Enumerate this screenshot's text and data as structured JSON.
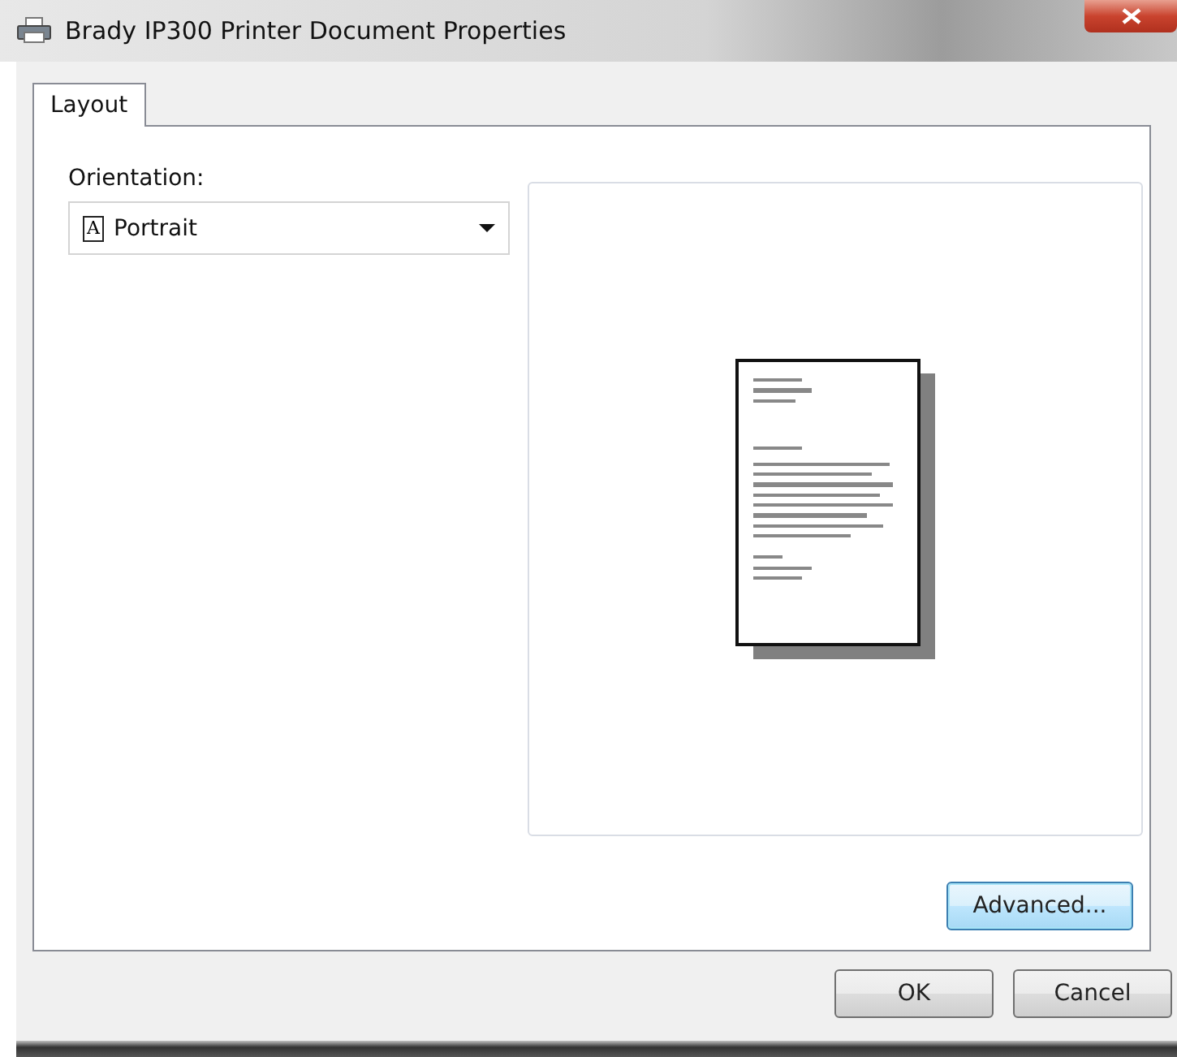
{
  "window": {
    "title": "Brady IP300 Printer Document Properties"
  },
  "tabs": [
    {
      "label": "Layout",
      "selected": true
    }
  ],
  "orientation": {
    "label": "Orientation:",
    "icon_glyph": "A",
    "value": "Portrait"
  },
  "panel_buttons": [
    {
      "label": "Advanced...",
      "focused": true
    }
  ],
  "buttons": [
    {
      "label": "OK",
      "focused": false
    },
    {
      "label": "Cancel",
      "focused": false
    }
  ]
}
